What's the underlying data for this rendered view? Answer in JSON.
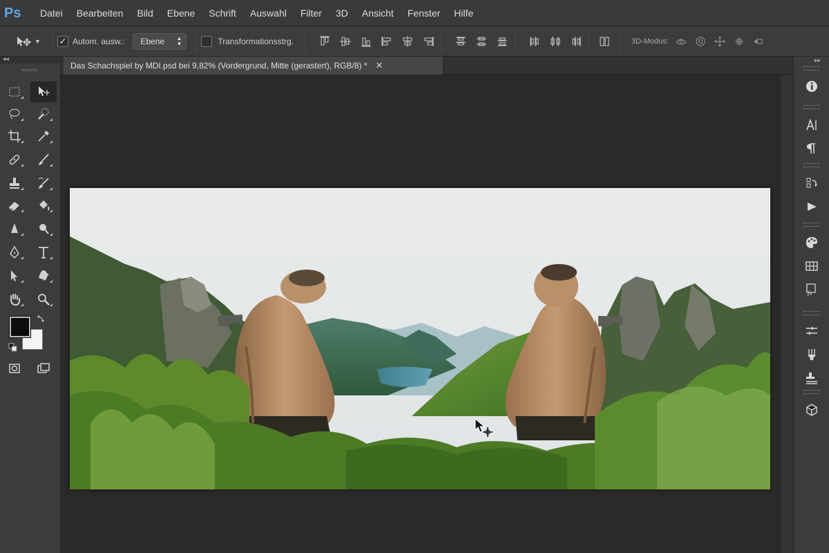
{
  "app": {
    "logo": "Ps"
  },
  "menu": [
    "Datei",
    "Bearbeiten",
    "Bild",
    "Ebene",
    "Schrift",
    "Auswahl",
    "Filter",
    "3D",
    "Ansicht",
    "Fenster",
    "Hilfe"
  ],
  "options": {
    "auto_select_label": "Autom. ausw.:",
    "auto_select_checked": true,
    "auto_select_value": "Ebene",
    "transform_label": "Transformationsstrg.",
    "transform_checked": false,
    "mode_label": "3D-Modus:"
  },
  "collapse": {
    "left": "◂◂",
    "right": "▸▸"
  },
  "document": {
    "tab_title": "Das Schachspiel by MDI.psd bei 9,82% (Vordergrund, Mitte (gerastert), RGB/8) *",
    "close_glyph": "✕"
  },
  "colors": {
    "foreground": "#0d0d0d",
    "background": "#f4f4f4",
    "accent": "#5fa7e8"
  },
  "tools": [
    "rect-marquee",
    "move",
    "lasso",
    "quick-selection",
    "crop",
    "eyedropper",
    "healing-brush",
    "brush",
    "clone-stamp",
    "history-brush",
    "eraser",
    "paint-bucket",
    "blur",
    "dodge",
    "pen",
    "type",
    "path-selection",
    "custom-shape",
    "hand",
    "zoom"
  ],
  "right_panels": [
    "info",
    "character",
    "paragraph",
    "history",
    "actions",
    "swatches",
    "styles",
    "layer-styles",
    "adjustments",
    "brushes",
    "layers",
    "3d"
  ]
}
